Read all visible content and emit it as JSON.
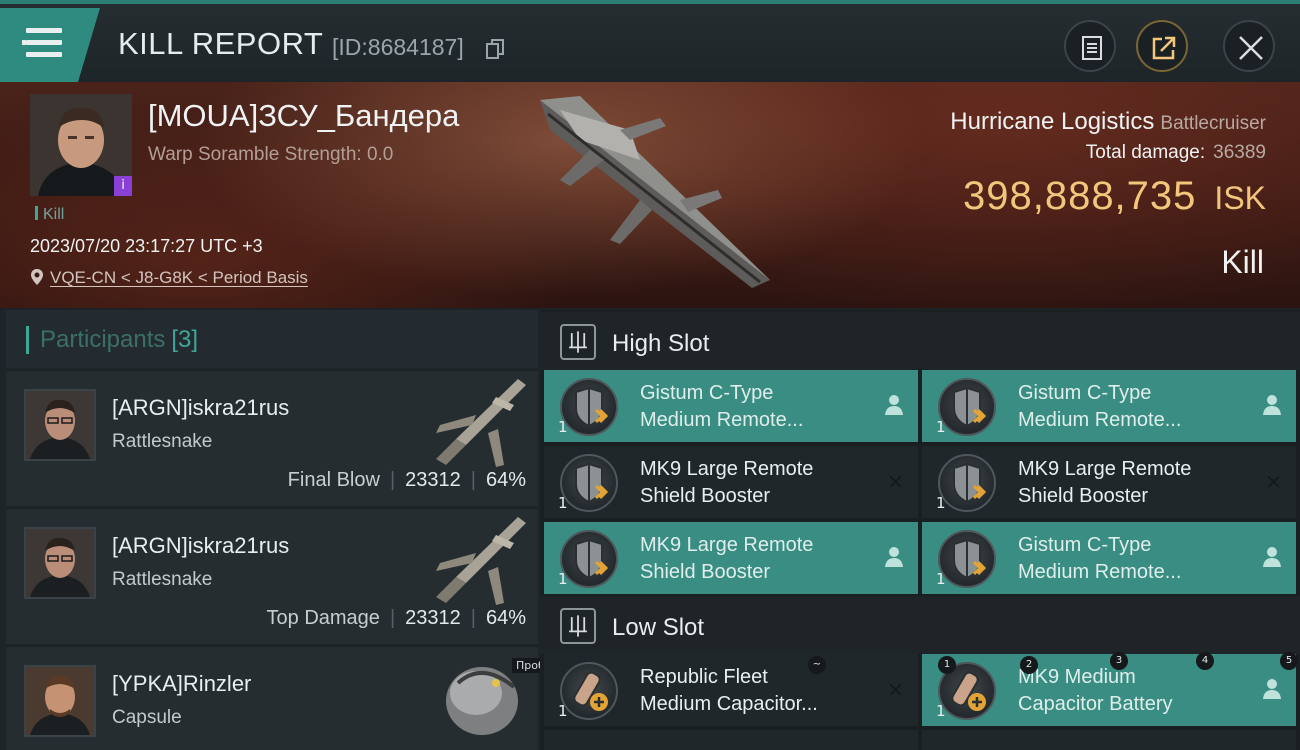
{
  "header": {
    "title": "KILL REPORT",
    "report_id": "[ID:8684187]"
  },
  "victim": {
    "name": "[MOUA]ЗСУ_Бандера",
    "warp_scramble": "Warp Soramble Strength: 0.0",
    "badge": "i",
    "kill_tag": "Kill",
    "datetime": "2023/07/20 23:17:27 UTC +3",
    "location": "VQE-CN < J8-G8K < Period Basis",
    "ship_name": "Hurricane Logistics",
    "ship_class": "Battlecruiser",
    "damage_label": "Total damage:",
    "damage_value": "36389",
    "isk_amount": "398,888,735",
    "isk_unit": "ISK",
    "result": "Kill"
  },
  "participants": {
    "title": "Participants",
    "count": "[3]",
    "items": [
      {
        "name": "[ARGN]iskra21rus",
        "ship": "Rattlesnake",
        "role": "Final Blow",
        "damage": "23312",
        "percent": "64%"
      },
      {
        "name": "[ARGN]iskra21rus",
        "ship": "Rattlesnake",
        "role": "Top Damage",
        "damage": "23312",
        "percent": "64%"
      },
      {
        "name": "[YPKA]Rinzler",
        "ship": "Capsule",
        "role": "",
        "damage": "",
        "percent": ""
      }
    ],
    "tooltip": "Пробел"
  },
  "fitting": {
    "high_slot_title": "High Slot",
    "low_slot_title": "Low Slot",
    "high_slots": [
      {
        "line1": "Gistum C-Type",
        "line2": "Medium Remote...",
        "qty": "1",
        "state": "teal",
        "marker": "person"
      },
      {
        "line1": "Gistum C-Type",
        "line2": "Medium Remote...",
        "qty": "1",
        "state": "teal",
        "marker": "person"
      },
      {
        "line1": "MK9 Large Remote",
        "line2": "Shield Booster",
        "qty": "1",
        "state": "dark",
        "marker": "x"
      },
      {
        "line1": "MK9 Large Remote",
        "line2": "Shield Booster",
        "qty": "1",
        "state": "dark",
        "marker": "x"
      },
      {
        "line1": "MK9 Large Remote",
        "line2": "Shield Booster",
        "qty": "1",
        "state": "teal",
        "marker": "person"
      },
      {
        "line1": "Gistum C-Type",
        "line2": "Medium Remote...",
        "qty": "1",
        "state": "teal",
        "marker": "person"
      }
    ],
    "low_slots": [
      {
        "line1": "Republic Fleet",
        "line2": "Medium Capacitor...",
        "qty": "1",
        "state": "dark",
        "marker": "x"
      },
      {
        "line1": "MK9 Medium",
        "line2": "Capacitor Battery",
        "qty": "1",
        "state": "teal",
        "marker": "person"
      }
    ],
    "hint_numbers": [
      "1",
      "2",
      "3",
      "4",
      "5",
      "~"
    ]
  },
  "colors": {
    "accent": "#3fa796",
    "teal_slot": "#3a8d82",
    "isk_gold": "#f3c77b",
    "badge_purple": "#8a3fd6"
  },
  "icons": [
    "menu-icon",
    "copy-icon",
    "clipboard-icon",
    "share-icon",
    "close-icon",
    "location-pin-icon",
    "slot-category-icon",
    "person-icon",
    "x-icon",
    "shield-booster-icon",
    "capacitor-icon"
  ]
}
